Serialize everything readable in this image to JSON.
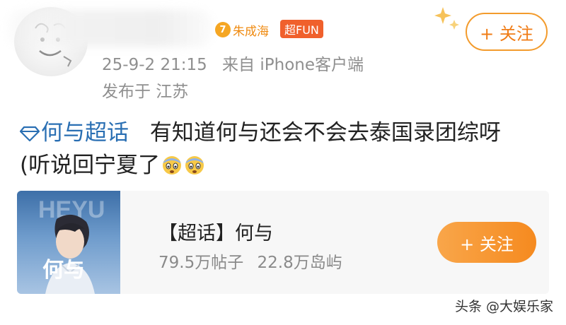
{
  "header": {
    "fan_badge": {
      "level": "7",
      "text": "朱成海"
    },
    "fun_badge": "超FUN",
    "timestamp": "25-9-2 21:15",
    "source": "来自 iPhone客户端",
    "location": "发布于 江苏",
    "follow_label": "+ 关注"
  },
  "post": {
    "topic": "何与超话",
    "text_line1": "有知道何与还会不会去泰国录团综呀",
    "text_line2": "(听说回宁夏了",
    "emoji": "cold-sweat-face-icon"
  },
  "card": {
    "cover_text": "何与",
    "title": "【超话】何与",
    "posts_count": "79.5万帖子",
    "islands_count": "22.8万岛屿",
    "follow_label": "+ 关注"
  },
  "watermark": "头条 @大娱乐家",
  "colors": {
    "accent_orange": "#f58a1f",
    "topic_blue": "#2a6fb3",
    "meta_gray": "#8f8f8f",
    "fun_badge_red": "#f0602c"
  }
}
